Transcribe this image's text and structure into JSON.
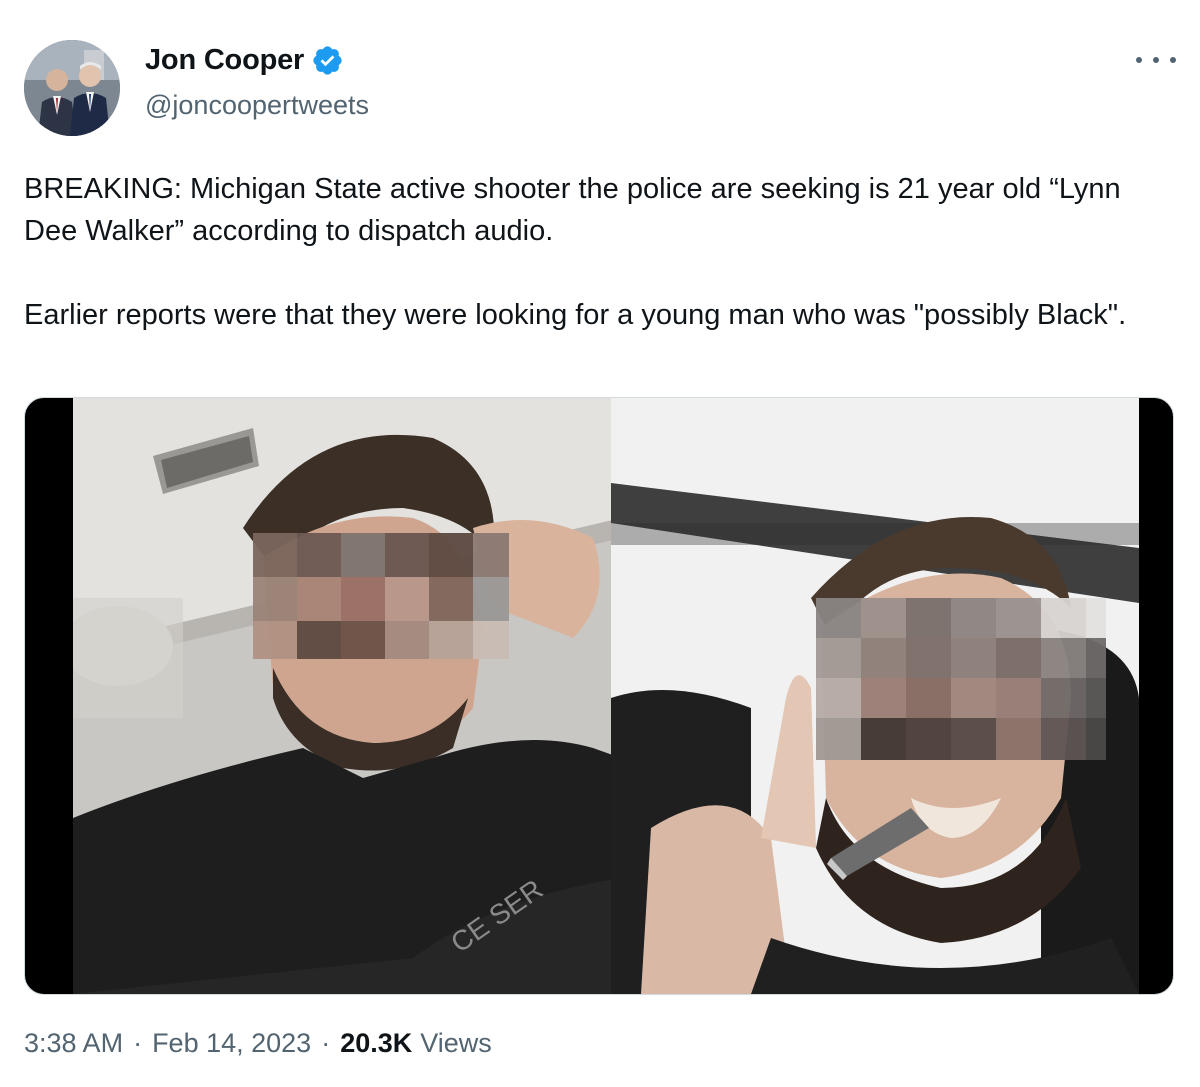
{
  "author": {
    "name": "Jon Cooper",
    "handle": "@joncoopertweets",
    "verified": true,
    "avatar_icon": "profile-photo"
  },
  "tweet": {
    "paragraphs": [
      "BREAKING: Michigan State active shooter the police are seeking is 21 year old “Lynn Dee Walker” according to dispatch audio.",
      "Earlier reports were that they were looking for a young man who was \"possibly Black\"."
    ]
  },
  "media": {
    "images": [
      {
        "name": "photo-left",
        "printed_text": "CE SER"
      },
      {
        "name": "photo-right"
      }
    ]
  },
  "meta": {
    "time": "3:38 AM",
    "separator": "·",
    "date": "Feb 14, 2023",
    "views_count": "20.3K",
    "views_label": "Views"
  },
  "colors": {
    "text": "#0f1419",
    "secondary": "#536471",
    "verified_blue": "#1d9bf0"
  }
}
